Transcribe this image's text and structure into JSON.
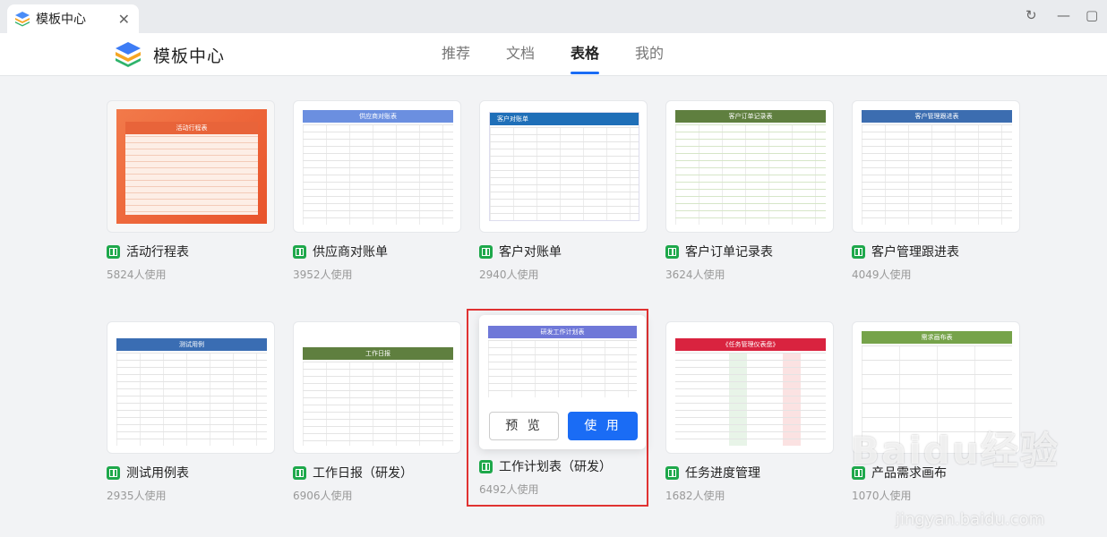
{
  "window": {
    "tab_title": "模板中心",
    "close_label": "✕",
    "refresh_label": "↻",
    "minimize_label": "—",
    "maximize_label": "▢"
  },
  "header": {
    "brand_title": "模板中心",
    "nav": [
      "推荐",
      "文档",
      "表格",
      "我的"
    ],
    "active_tab": "表格"
  },
  "colors": {
    "accent": "#1a6cf5",
    "highlight": "#e03232",
    "sheet_green": "#1ea84b"
  },
  "cards": [
    {
      "name": "活动行程表",
      "count": "5824人使用",
      "thumb_title": "活动行程表"
    },
    {
      "name": "供应商对账单",
      "count": "3952人使用",
      "thumb_title": "供应商对账表"
    },
    {
      "name": "客户对账单",
      "count": "2940人使用",
      "thumb_title": "客户对账单"
    },
    {
      "name": "客户订单记录表",
      "count": "3624人使用",
      "thumb_title": "客户订单记录表"
    },
    {
      "name": "客户管理跟进表",
      "count": "4049人使用",
      "thumb_title": "客户管理跟进表"
    },
    {
      "name": "测试用例表",
      "count": "2935人使用",
      "thumb_title": "测试用例"
    },
    {
      "name": "工作日报（研发）",
      "count": "6906人使用",
      "thumb_title": "工作日报"
    },
    {
      "name": "工作计划表（研发）",
      "count": "6492人使用",
      "thumb_title": "研发工作计划表"
    },
    {
      "name": "任务进度管理",
      "count": "1682人使用",
      "thumb_title": "《任务管理仪表盘》"
    },
    {
      "name": "产品需求画布",
      "count": "1070人使用",
      "thumb_title": "需求画布表"
    }
  ],
  "hover": {
    "preview_label": "预 览",
    "use_label": "使 用"
  },
  "watermark": {
    "text": "Baidu经验",
    "url": "jingyan.baidu.com"
  }
}
